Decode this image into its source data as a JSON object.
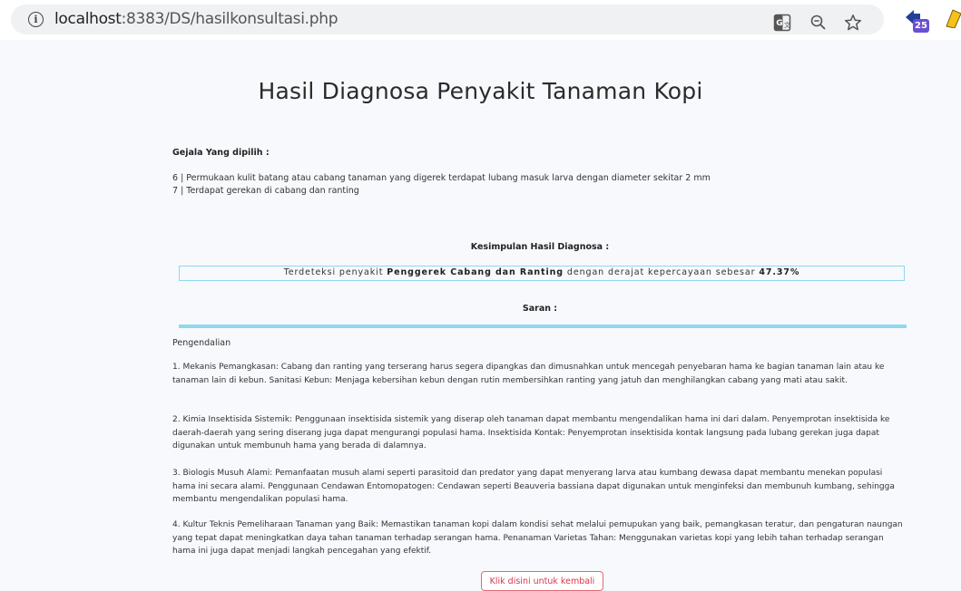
{
  "browser": {
    "url_host": "localhost",
    "url_path": ":8383/DS/hasilkonsultasi.php",
    "extension_badge": "25"
  },
  "page": {
    "title": "Hasil Diagnosa Penyakit Tanaman Kopi"
  },
  "symptoms": {
    "heading": "Gejala Yang dipilih :",
    "items": [
      "6 | Permukaan kulit batang atau cabang tanaman yang digerek terdapat lubang masuk larva dengan diameter sekitar 2 mm",
      "7 | Terdapat gerekan di cabang dan ranting"
    ]
  },
  "conclusion": {
    "heading": "Kesimpulan Hasil Diagnosa :",
    "prefix": "Terdeteksi penyakit ",
    "disease": "Penggerek Cabang dan Ranting",
    "middle": " dengan derajat kepercayaan sebesar ",
    "confidence": "47.37%"
  },
  "advice": {
    "heading": "Saran :",
    "intro": "Pengendalian",
    "items": [
      "1. Mekanis Pemangkasan: Cabang dan ranting yang terserang harus segera dipangkas dan dimusnahkan untuk mencegah penyebaran hama ke bagian tanaman lain atau ke tanaman lain di kebun. Sanitasi Kebun: Menjaga kebersihan kebun dengan rutin membersihkan ranting yang jatuh dan menghilangkan cabang yang mati atau sakit.",
      "2. Kimia Insektisida Sistemik: Penggunaan insektisida sistemik yang diserap oleh tanaman dapat membantu mengendalikan hama ini dari dalam. Penyemprotan insektisida ke daerah-daerah yang sering diserang juga dapat mengurangi populasi hama. Insektisida Kontak: Penyemprotan insektisida kontak langsung pada lubang gerekan juga dapat digunakan untuk membunuh hama yang berada di dalamnya.",
      "3. Biologis Musuh Alami: Pemanfaatan musuh alami seperti parasitoid dan predator yang dapat menyerang larva atau kumbang dewasa dapat membantu menekan populasi hama ini secara alami. Penggunaan Cendawan Entomopatogen: Cendawan seperti Beauveria bassiana dapat digunakan untuk menginfeksi dan membunuh kumbang, sehingga membantu mengendalikan populasi hama.",
      "4. Kultur Teknis Pemeliharaan Tanaman yang Baik: Memastikan tanaman kopi dalam kondisi sehat melalui pemupukan yang baik, pemangkasan teratur, dan pengaturan naungan yang tepat dapat meningkatkan daya tahan tanaman terhadap serangan hama. Penanaman Varietas Tahan: Menggunakan varietas kopi yang lebih tahan terhadap serangan hama ini juga dapat menjadi langkah pencegahan yang efektif."
    ]
  },
  "back_button": {
    "label": "Klik disini untuk kembali"
  },
  "colors": {
    "accent_border": "#8fd8ef",
    "button_red": "#d9364a",
    "extension_purple": "#6a4fd1"
  }
}
